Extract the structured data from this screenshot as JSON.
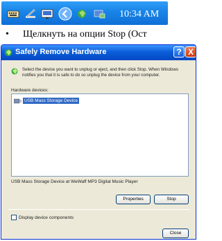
{
  "taskbar": {
    "clock": "10:34 AM",
    "icons": [
      "keyboard-icon",
      "pen-icon",
      "display-icon",
      "chevron-left-icon",
      "network-icon",
      "safely-remove-icon"
    ],
    "bar_color": "#1a86e8"
  },
  "bullet": {
    "symbol": "•",
    "text": "Щелкнуть на опции Stop (Ост"
  },
  "dialog": {
    "title": "Safely Remove Hardware",
    "help_label": "?",
    "close_label": "X",
    "intro": "Select the device you want to unplug or eject, and then click Stop. When Windows notifies you that it is safe to do so unplug the device from your computer.",
    "devices_label": "Hardware devices:",
    "devices": [
      {
        "label": "USB Mass Storage Device",
        "selected": true
      }
    ],
    "device_description": "USB Mass Storage Device at WeWaff MP3 Digital Music Player",
    "properties_label": "Properties",
    "stop_label": "Stop",
    "checkbox_label": "Display device components",
    "checkbox_checked": false,
    "close_button_label": "Close",
    "title_color": "#0347c4",
    "selection_color": "#316ac5"
  }
}
